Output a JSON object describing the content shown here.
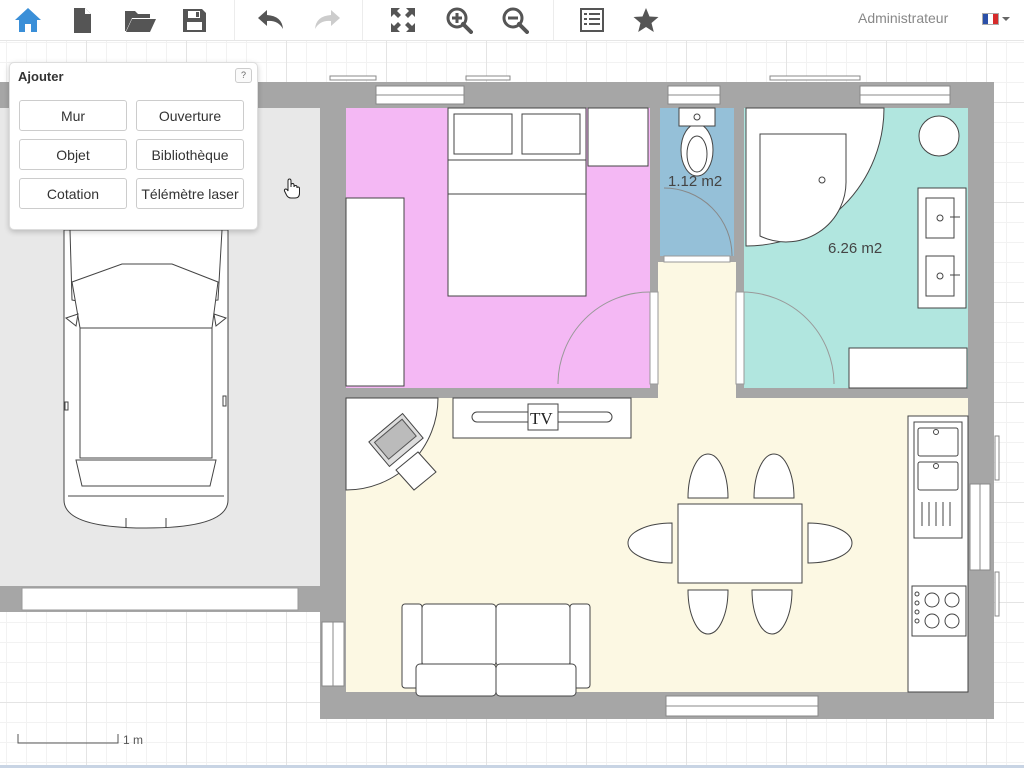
{
  "toolbar": {
    "buttons": [
      {
        "name": "home-button",
        "icon": "home-icon"
      },
      {
        "name": "new-file-button",
        "icon": "file-icon"
      },
      {
        "name": "open-button",
        "icon": "folder-open-icon"
      },
      {
        "name": "save-button",
        "icon": "floppy-icon"
      },
      {
        "name": "undo-button",
        "icon": "undo-icon"
      },
      {
        "name": "redo-button",
        "icon": "redo-icon"
      },
      {
        "name": "fullscreen-button",
        "icon": "fullscreen-icon"
      },
      {
        "name": "zoom-in-button",
        "icon": "zoom-in-icon"
      },
      {
        "name": "zoom-out-button",
        "icon": "zoom-out-icon"
      },
      {
        "name": "list-button",
        "icon": "list-icon"
      },
      {
        "name": "favorite-button",
        "icon": "star-icon"
      }
    ],
    "colors": {
      "home": "#3a8fd8",
      "icon": "#555555",
      "disabled": "#cccccc"
    }
  },
  "user": {
    "name": "Administrateur",
    "flag_colors": [
      "#2a4fa8",
      "#ffffff",
      "#d62b2b"
    ]
  },
  "panel": {
    "title": "Ajouter",
    "help": "?",
    "buttons": {
      "mur": "Mur",
      "ouverture": "Ouverture",
      "objet": "Objet",
      "bibliotheque": "Bibliothèque",
      "cotation": "Cotation",
      "telemetre": "Télémètre laser"
    }
  },
  "plan": {
    "rooms": [
      {
        "name": "bedroom",
        "color": "#f4b8f4"
      },
      {
        "name": "wc",
        "color": "#95c0d8",
        "area": "1.12 m2"
      },
      {
        "name": "bathroom",
        "color": "#b1e6df",
        "area": "6.26 m2"
      },
      {
        "name": "living",
        "color": "#fcf8e3"
      },
      {
        "name": "garage",
        "color": "#e8e8e8"
      }
    ],
    "wall_color": "#a6a6a6",
    "tv_label": "TV"
  },
  "scale": {
    "label": "1 m"
  }
}
